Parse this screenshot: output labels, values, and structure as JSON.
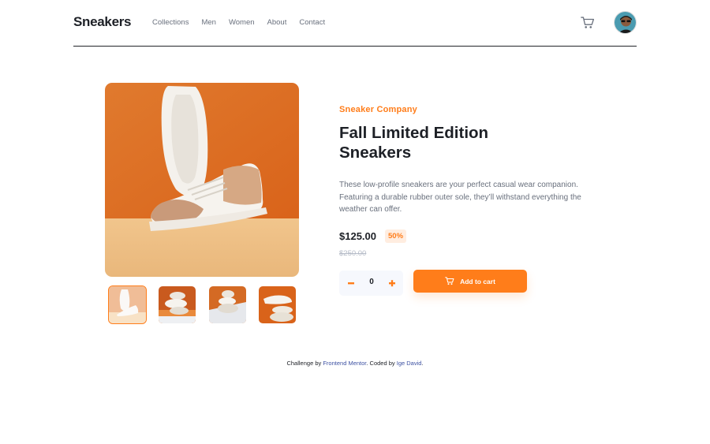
{
  "header": {
    "logo": "Sneakers",
    "nav": [
      "Collections",
      "Men",
      "Women",
      "About",
      "Contact"
    ]
  },
  "product": {
    "company": "Sneaker Company",
    "title": "Fall Limited Edition Sneakers",
    "description": "These low-profile sneakers are your perfect casual wear companion. Featuring a durable rubber outer sole, they’ll withstand everything the weather can offer.",
    "price": "$125.00",
    "discount": "50%",
    "old_price": "$250.00",
    "quantity": "0",
    "add_to_cart": "Add to cart"
  },
  "footer": {
    "prefix": "Challenge by ",
    "link1": "Frontend Mentor",
    "middle": ". Coded by ",
    "link2": "Ige David",
    "suffix": "."
  },
  "colors": {
    "accent": "#ff7d1a",
    "accent_pale": "#ffede0",
    "text_dark": "#1d2026",
    "text_grey": "#69707d"
  },
  "icons": [
    "cart-icon",
    "minus-icon",
    "plus-icon",
    "avatar"
  ]
}
